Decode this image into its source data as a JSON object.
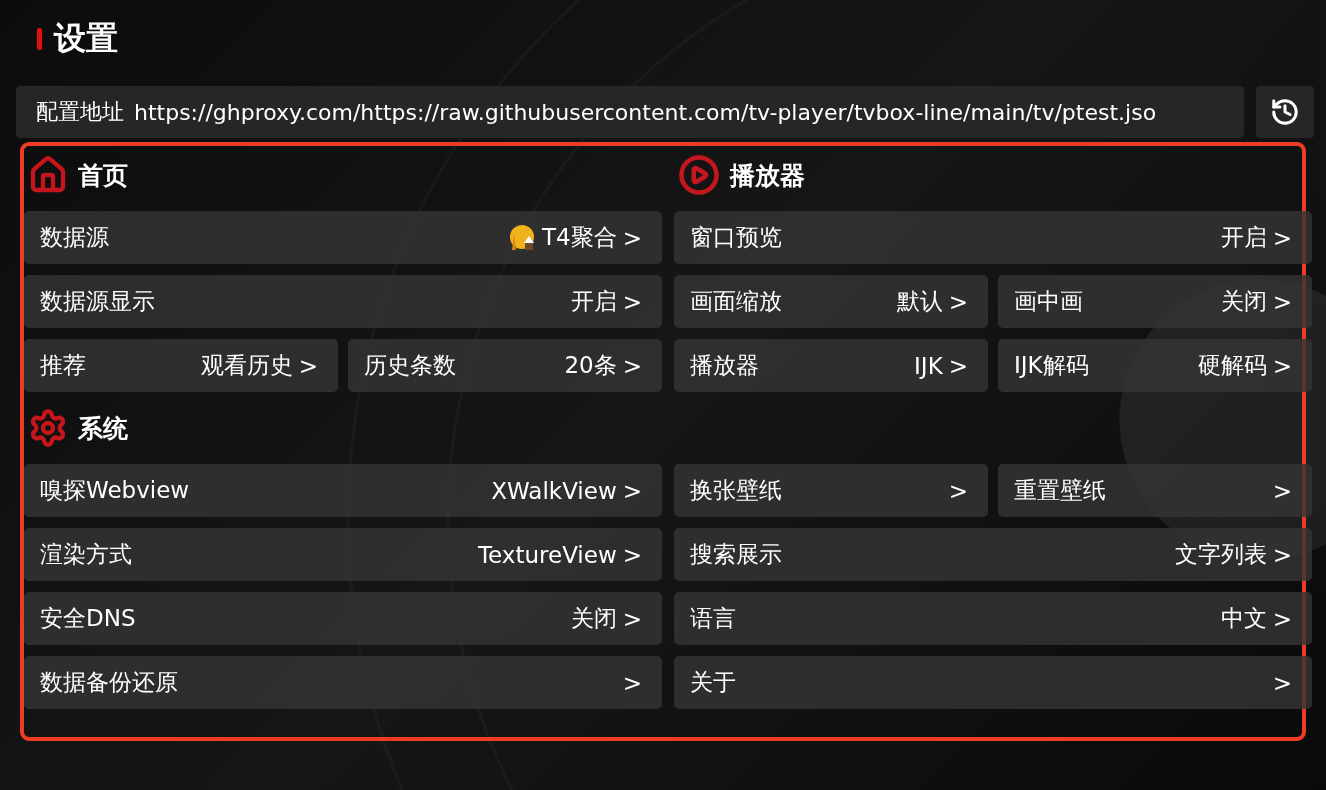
{
  "title": "设置",
  "config": {
    "label": "配置地址",
    "value": "https://ghproxy.com/https://raw.githubusercontent.com/tv-player/tvbox-line/main/tv/ptest.jso"
  },
  "columns": [
    {
      "sections": [
        {
          "kind": "home",
          "title": "首页",
          "rows": [
            [
              {
                "kind": "source",
                "label": "数据源",
                "value": "T4聚合",
                "arrow": ">"
              }
            ],
            [
              {
                "kind": "plain",
                "label": "数据源显示",
                "value": "开启",
                "arrow": ">"
              }
            ],
            [
              {
                "kind": "plain",
                "label": "推荐",
                "value": "观看历史",
                "arrow": ">"
              },
              {
                "kind": "plain",
                "label": "历史条数",
                "value": "20条",
                "arrow": ">"
              }
            ]
          ]
        },
        {
          "kind": "system",
          "title": "系统",
          "rows": [
            [
              {
                "kind": "plain",
                "label": "嗅探Webview",
                "value": "XWalkView",
                "arrow": ">"
              }
            ],
            [
              {
                "kind": "plain",
                "label": "渲染方式",
                "value": "TextureView",
                "arrow": ">"
              }
            ],
            [
              {
                "kind": "plain",
                "label": "安全DNS",
                "value": "关闭",
                "arrow": ">"
              }
            ],
            [
              {
                "kind": "plain",
                "label": "数据备份还原",
                "arrow": ">"
              }
            ]
          ]
        }
      ]
    },
    {
      "sections": [
        {
          "kind": "player",
          "title": "播放器",
          "rows": [
            [
              {
                "kind": "plain",
                "label": "窗口预览",
                "value": "开启",
                "arrow": ">"
              }
            ],
            [
              {
                "kind": "plain",
                "label": "画面缩放",
                "value": "默认",
                "arrow": ">"
              },
              {
                "kind": "plain",
                "label": "画中画",
                "value": "关闭",
                "arrow": ">"
              }
            ],
            [
              {
                "kind": "plain",
                "label": "播放器",
                "value": "IJK",
                "arrow": ">"
              },
              {
                "kind": "plain",
                "label": "IJK解码",
                "value": "硬解码",
                "arrow": ">"
              }
            ]
          ]
        },
        {
          "rows": [
            [
              {
                "kind": "plain",
                "label": "换张壁纸",
                "arrow": ">"
              },
              {
                "kind": "plain",
                "label": "重置壁纸",
                "arrow": ">"
              }
            ],
            [
              {
                "kind": "plain",
                "label": "搜索展示",
                "value": "文字列表",
                "arrow": ">"
              }
            ],
            [
              {
                "kind": "plain",
                "label": "语言",
                "value": "中文",
                "arrow": ">"
              }
            ],
            [
              {
                "kind": "plain",
                "label": "关于",
                "arrow": ">"
              }
            ]
          ]
        }
      ]
    }
  ]
}
